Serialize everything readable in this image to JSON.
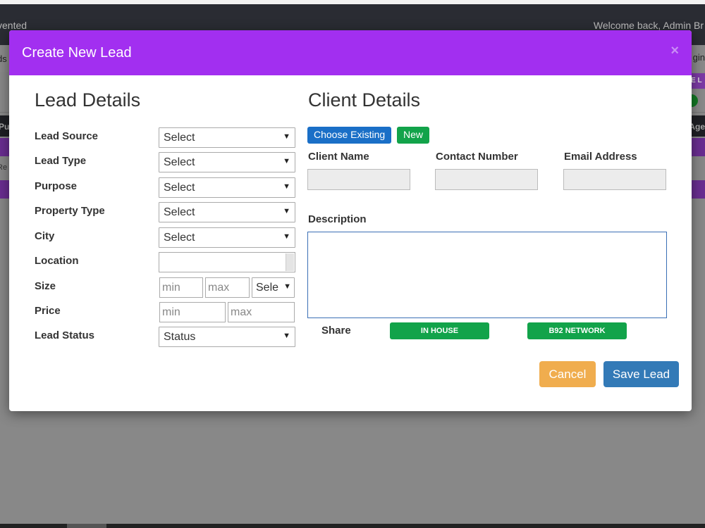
{
  "background": {
    "brand_fragment": "vented",
    "welcome_text": "Welcome back, Admin Br",
    "nav_left_fragment": "ds",
    "nav_right_fragment": "gin",
    "purple_tag_fragment": "E L",
    "table_head_left": "Pu",
    "table_head_right": "Age",
    "row_text_fragment": "Re"
  },
  "modal": {
    "title": "Create New Lead",
    "close_label": "×"
  },
  "lead_details": {
    "title": "Lead Details",
    "fields": {
      "lead_source": {
        "label": "Lead Source",
        "value": "Select"
      },
      "lead_type": {
        "label": "Lead Type",
        "value": "Select"
      },
      "purpose": {
        "label": "Purpose",
        "value": "Select"
      },
      "property_type": {
        "label": "Property Type",
        "value": "Select"
      },
      "city": {
        "label": "City",
        "value": "Select"
      },
      "location": {
        "label": "Location",
        "value": ""
      },
      "size": {
        "label": "Size",
        "min_placeholder": "min",
        "max_placeholder": "max",
        "unit_value": "Sele"
      },
      "price": {
        "label": "Price",
        "min_placeholder": "min",
        "max_placeholder": "max"
      },
      "lead_status": {
        "label": "Lead Status",
        "value": "Status"
      }
    },
    "caret": "▼"
  },
  "client_details": {
    "title": "Client Details",
    "choose_existing_label": "Choose Existing",
    "new_label": "New",
    "client_name_label": "Client Name",
    "contact_number_label": "Contact Number",
    "email_address_label": "Email Address",
    "description_label": "Description",
    "share_label": "Share",
    "share_options": [
      "IN HOUSE",
      "B92 NETWORK"
    ]
  },
  "footer": {
    "cancel_label": "Cancel",
    "save_label": "Save Lead"
  },
  "colors": {
    "header_purple": "#a22ff0",
    "choose_existing_blue": "#1a6fc7",
    "green": "#12a34a",
    "cancel_orange": "#f0ad4e",
    "save_blue": "#337ab7"
  }
}
